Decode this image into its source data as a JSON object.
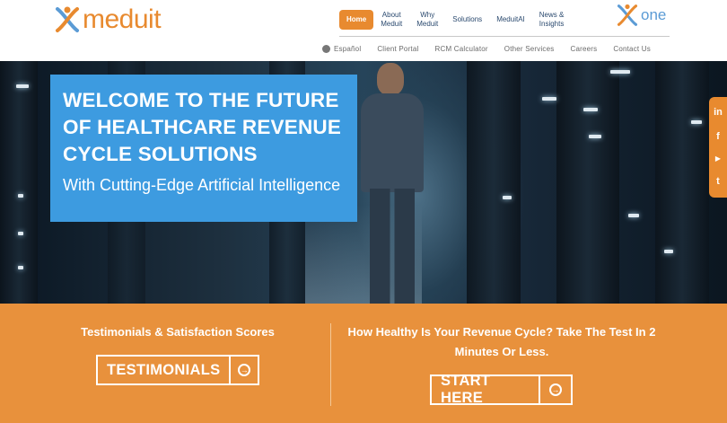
{
  "header": {
    "logo_text": "meduit",
    "one_text": "one",
    "nav": [
      {
        "label": "Home",
        "active": true
      },
      {
        "label": "About\nMeduit",
        "active": false
      },
      {
        "label": "Why\nMeduit",
        "active": false
      },
      {
        "label": "Solutions",
        "active": false
      },
      {
        "label": "MeduitAI",
        "active": false
      },
      {
        "label": "News &\nInsights",
        "active": false
      }
    ],
    "subnav": [
      "Español",
      "Client Portal",
      "RCM Calculator",
      "Other Services",
      "Careers",
      "Contact Us"
    ]
  },
  "hero": {
    "title": "WELCOME TO THE FUTURE OF HEALTHCARE REVENUE CYCLE SOLUTIONS",
    "subtitle": "With Cutting-Edge Artificial Intelligence"
  },
  "social": {
    "icons": [
      "linkedin-icon",
      "facebook-icon",
      "youtube-icon",
      "twitter-icon"
    ],
    "glyphs": [
      "in",
      "f",
      "▶",
      "t"
    ]
  },
  "band": {
    "left_heading": "Testimonials & Satisfaction Scores",
    "left_button": "TESTIMONIALS",
    "right_heading": "How Healthy Is Your Revenue Cycle? Take The Test In 2 Minutes Or Less.",
    "right_button": "START HERE",
    "arrow_glyph": "→"
  },
  "colors": {
    "brand_orange": "#e88a2f",
    "hero_box_blue": "#3d9be0",
    "nav_text": "#2b4a6f",
    "one_blue": "#5b9bd5"
  }
}
